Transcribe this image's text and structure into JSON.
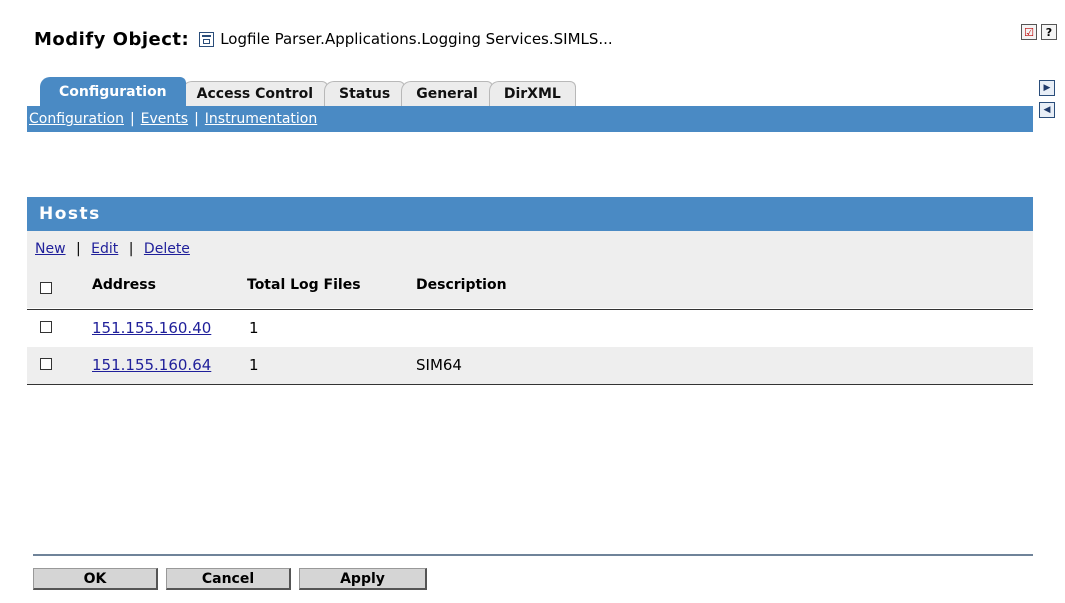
{
  "title": {
    "label": "Modify Object:",
    "object_name": "Logfile Parser.Applications.Logging Services.SIMLS..."
  },
  "top_icons": {
    "tasks": "☑",
    "help": "?"
  },
  "tabs": [
    {
      "label": "Configuration",
      "active": true
    },
    {
      "label": "Access Control",
      "active": false
    },
    {
      "label": "Status",
      "active": false
    },
    {
      "label": "General",
      "active": false
    },
    {
      "label": "DirXML",
      "active": false
    }
  ],
  "subtabs": [
    {
      "label": "Configuration"
    },
    {
      "label": "Events"
    },
    {
      "label": "Instrumentation"
    }
  ],
  "subtab_separator": "|",
  "nav": {
    "next": "▶",
    "prev": "◀"
  },
  "hosts": {
    "title": "Hosts",
    "actions": {
      "new": "New",
      "edit": "Edit",
      "delete": "Delete",
      "separator": "|"
    },
    "columns": {
      "address": "Address",
      "total_log_files": "Total Log Files",
      "description": "Description"
    },
    "rows": [
      {
        "address": "151.155.160.40",
        "total_log_files": "1",
        "description": ""
      },
      {
        "address": "151.155.160.64",
        "total_log_files": "1",
        "description": "SIM64"
      }
    ]
  },
  "buttons": {
    "ok": "OK",
    "cancel": "Cancel",
    "apply": "Apply"
  },
  "colors": {
    "accent": "#4a8ac4",
    "panel": "#eeeeee",
    "link": "#1f1f9a"
  }
}
